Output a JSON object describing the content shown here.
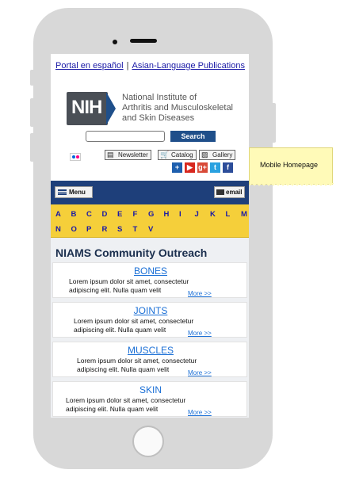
{
  "top_links": {
    "spanish": "Portal en español",
    "separator": "|",
    "asian": "Asian-Language Publications"
  },
  "logo": {
    "mark": "NIH",
    "line1": "National Institute of",
    "line2": "Arthritis and Musculoskeletal",
    "line3": "and Skin Diseases"
  },
  "search": {
    "input_value": "",
    "button_label": "Search"
  },
  "toolbar": {
    "newsletter": "Newsletter",
    "catalog": "Catalog",
    "gallery": "Gallery"
  },
  "social": {
    "add": "+",
    "youtube": "▶",
    "google": "g+",
    "twitter": "t",
    "facebook": "f"
  },
  "nav": {
    "menu_label": "Menu",
    "email_label": "email"
  },
  "alphabet": {
    "row1": [
      "A",
      "B",
      "C",
      "D",
      "E",
      "F",
      "G",
      "H",
      "I",
      "J",
      "K",
      "L",
      "M"
    ],
    "row2": [
      "N",
      "O",
      "P",
      "R",
      "S",
      "T",
      "V"
    ]
  },
  "section_title": "NIAMS Community Outreach",
  "cards": [
    {
      "title": "BONES",
      "line1": "Lorem ipsum dolor sit amet, consectetur",
      "line2": "adipiscing elit. Nulla quam velit",
      "more": "More >>"
    },
    {
      "title": "JOINTS",
      "line1": "Lorem ipsum dolor sit amet, consectetur",
      "line2": "adipiscing elit. Nulla quam velit",
      "more": "More >>"
    },
    {
      "title": "MUSCLES",
      "line1": "Lorem ipsum dolor sit amet, consectetur",
      "line2": "adipiscing elit. Nulla quam velit",
      "more": "More >>"
    },
    {
      "title": "SKIN",
      "line1": "Lorem ipsum dolor sit amet, consectetur",
      "line2": "adipiscing elit. Nulla quam velit",
      "more": "More >>"
    }
  ],
  "note": {
    "text": "Mobile Homepage"
  },
  "colors": {
    "nav_blue": "#1e3f7a",
    "alpha_yellow": "#f5cf3a",
    "link_blue": "#1a6fd6",
    "note_yellow": "#fffab8"
  }
}
